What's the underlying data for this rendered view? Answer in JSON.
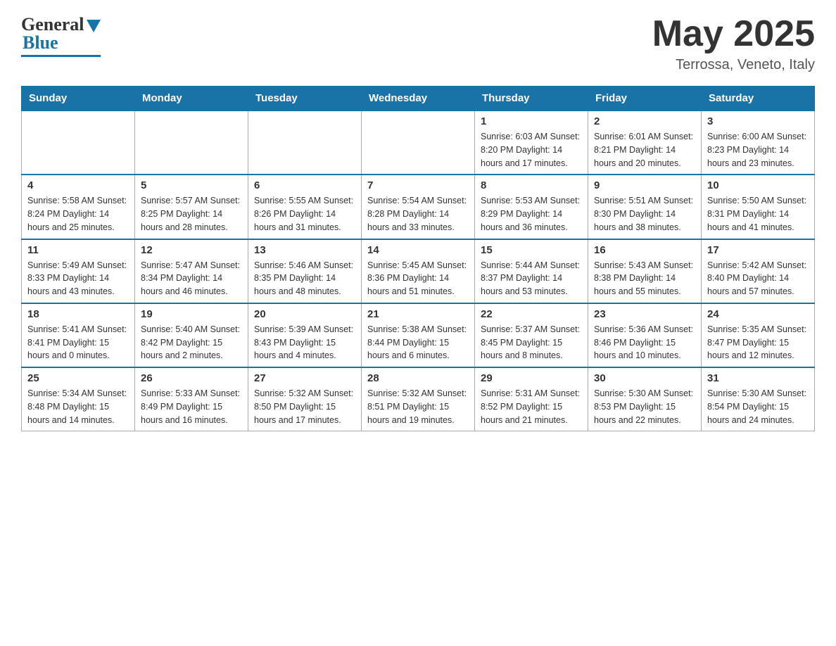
{
  "logo": {
    "text_general": "General",
    "text_blue": "Blue"
  },
  "title": {
    "month_year": "May 2025",
    "location": "Terrossa, Veneto, Italy"
  },
  "weekdays": [
    "Sunday",
    "Monday",
    "Tuesday",
    "Wednesday",
    "Thursday",
    "Friday",
    "Saturday"
  ],
  "weeks": [
    [
      {
        "day": "",
        "info": ""
      },
      {
        "day": "",
        "info": ""
      },
      {
        "day": "",
        "info": ""
      },
      {
        "day": "",
        "info": ""
      },
      {
        "day": "1",
        "info": "Sunrise: 6:03 AM\nSunset: 8:20 PM\nDaylight: 14 hours and 17 minutes."
      },
      {
        "day": "2",
        "info": "Sunrise: 6:01 AM\nSunset: 8:21 PM\nDaylight: 14 hours and 20 minutes."
      },
      {
        "day": "3",
        "info": "Sunrise: 6:00 AM\nSunset: 8:23 PM\nDaylight: 14 hours and 23 minutes."
      }
    ],
    [
      {
        "day": "4",
        "info": "Sunrise: 5:58 AM\nSunset: 8:24 PM\nDaylight: 14 hours and 25 minutes."
      },
      {
        "day": "5",
        "info": "Sunrise: 5:57 AM\nSunset: 8:25 PM\nDaylight: 14 hours and 28 minutes."
      },
      {
        "day": "6",
        "info": "Sunrise: 5:55 AM\nSunset: 8:26 PM\nDaylight: 14 hours and 31 minutes."
      },
      {
        "day": "7",
        "info": "Sunrise: 5:54 AM\nSunset: 8:28 PM\nDaylight: 14 hours and 33 minutes."
      },
      {
        "day": "8",
        "info": "Sunrise: 5:53 AM\nSunset: 8:29 PM\nDaylight: 14 hours and 36 minutes."
      },
      {
        "day": "9",
        "info": "Sunrise: 5:51 AM\nSunset: 8:30 PM\nDaylight: 14 hours and 38 minutes."
      },
      {
        "day": "10",
        "info": "Sunrise: 5:50 AM\nSunset: 8:31 PM\nDaylight: 14 hours and 41 minutes."
      }
    ],
    [
      {
        "day": "11",
        "info": "Sunrise: 5:49 AM\nSunset: 8:33 PM\nDaylight: 14 hours and 43 minutes."
      },
      {
        "day": "12",
        "info": "Sunrise: 5:47 AM\nSunset: 8:34 PM\nDaylight: 14 hours and 46 minutes."
      },
      {
        "day": "13",
        "info": "Sunrise: 5:46 AM\nSunset: 8:35 PM\nDaylight: 14 hours and 48 minutes."
      },
      {
        "day": "14",
        "info": "Sunrise: 5:45 AM\nSunset: 8:36 PM\nDaylight: 14 hours and 51 minutes."
      },
      {
        "day": "15",
        "info": "Sunrise: 5:44 AM\nSunset: 8:37 PM\nDaylight: 14 hours and 53 minutes."
      },
      {
        "day": "16",
        "info": "Sunrise: 5:43 AM\nSunset: 8:38 PM\nDaylight: 14 hours and 55 minutes."
      },
      {
        "day": "17",
        "info": "Sunrise: 5:42 AM\nSunset: 8:40 PM\nDaylight: 14 hours and 57 minutes."
      }
    ],
    [
      {
        "day": "18",
        "info": "Sunrise: 5:41 AM\nSunset: 8:41 PM\nDaylight: 15 hours and 0 minutes."
      },
      {
        "day": "19",
        "info": "Sunrise: 5:40 AM\nSunset: 8:42 PM\nDaylight: 15 hours and 2 minutes."
      },
      {
        "day": "20",
        "info": "Sunrise: 5:39 AM\nSunset: 8:43 PM\nDaylight: 15 hours and 4 minutes."
      },
      {
        "day": "21",
        "info": "Sunrise: 5:38 AM\nSunset: 8:44 PM\nDaylight: 15 hours and 6 minutes."
      },
      {
        "day": "22",
        "info": "Sunrise: 5:37 AM\nSunset: 8:45 PM\nDaylight: 15 hours and 8 minutes."
      },
      {
        "day": "23",
        "info": "Sunrise: 5:36 AM\nSunset: 8:46 PM\nDaylight: 15 hours and 10 minutes."
      },
      {
        "day": "24",
        "info": "Sunrise: 5:35 AM\nSunset: 8:47 PM\nDaylight: 15 hours and 12 minutes."
      }
    ],
    [
      {
        "day": "25",
        "info": "Sunrise: 5:34 AM\nSunset: 8:48 PM\nDaylight: 15 hours and 14 minutes."
      },
      {
        "day": "26",
        "info": "Sunrise: 5:33 AM\nSunset: 8:49 PM\nDaylight: 15 hours and 16 minutes."
      },
      {
        "day": "27",
        "info": "Sunrise: 5:32 AM\nSunset: 8:50 PM\nDaylight: 15 hours and 17 minutes."
      },
      {
        "day": "28",
        "info": "Sunrise: 5:32 AM\nSunset: 8:51 PM\nDaylight: 15 hours and 19 minutes."
      },
      {
        "day": "29",
        "info": "Sunrise: 5:31 AM\nSunset: 8:52 PM\nDaylight: 15 hours and 21 minutes."
      },
      {
        "day": "30",
        "info": "Sunrise: 5:30 AM\nSunset: 8:53 PM\nDaylight: 15 hours and 22 minutes."
      },
      {
        "day": "31",
        "info": "Sunrise: 5:30 AM\nSunset: 8:54 PM\nDaylight: 15 hours and 24 minutes."
      }
    ]
  ]
}
